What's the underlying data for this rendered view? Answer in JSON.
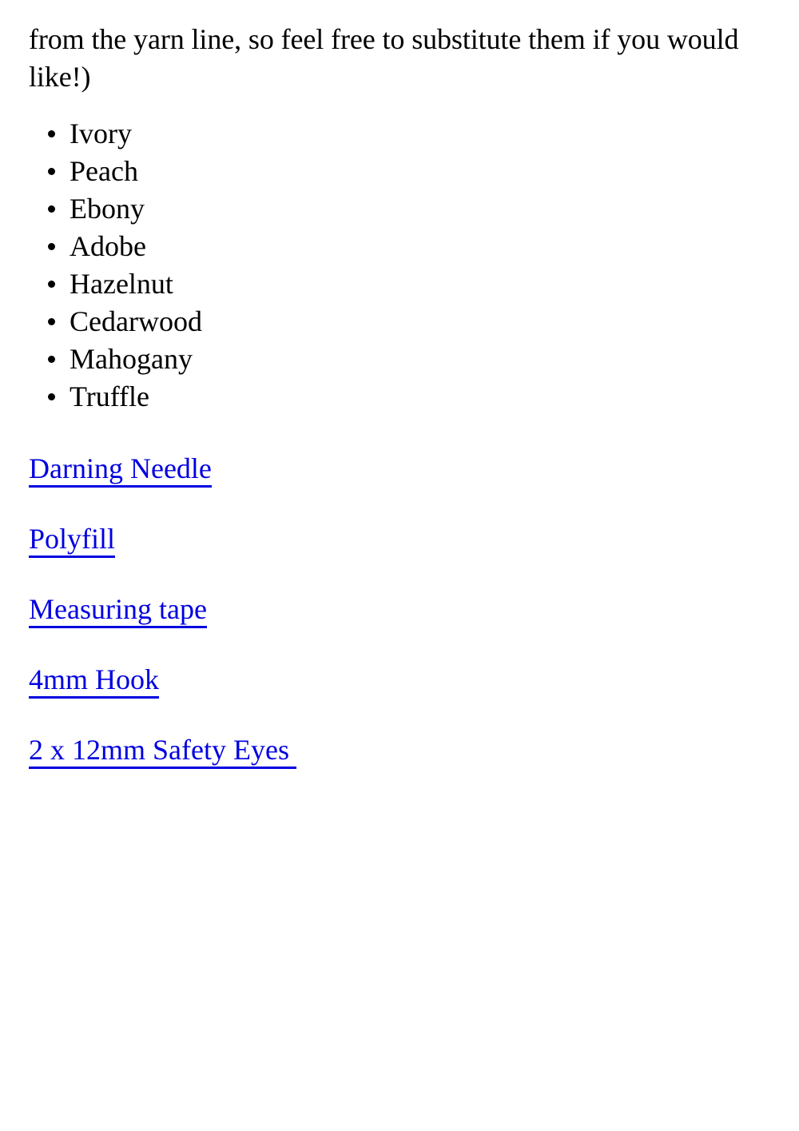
{
  "page": {
    "background_color": "#ffffff",
    "text_color": "#000000",
    "link_color": "#0000e0"
  },
  "intro": {
    "text": "from the yarn line, so feel free to substitute them if you would like!)"
  },
  "color_list": {
    "marker": "bullet",
    "items": [
      {
        "label": "Ivory"
      },
      {
        "label": "Peach"
      },
      {
        "label": "Ebony"
      },
      {
        "label": "Adobe"
      },
      {
        "label": "Hazelnut"
      },
      {
        "label": "Cedarwood"
      },
      {
        "label": "Mahogany"
      },
      {
        "label": "Truffle"
      }
    ]
  },
  "links": [
    {
      "label": "Darning Needle"
    },
    {
      "label": "Polyfill"
    },
    {
      "label": "Measuring tape"
    },
    {
      "label": "4mm Hook"
    },
    {
      "label": "2 x 12mm Safety Eyes "
    }
  ]
}
